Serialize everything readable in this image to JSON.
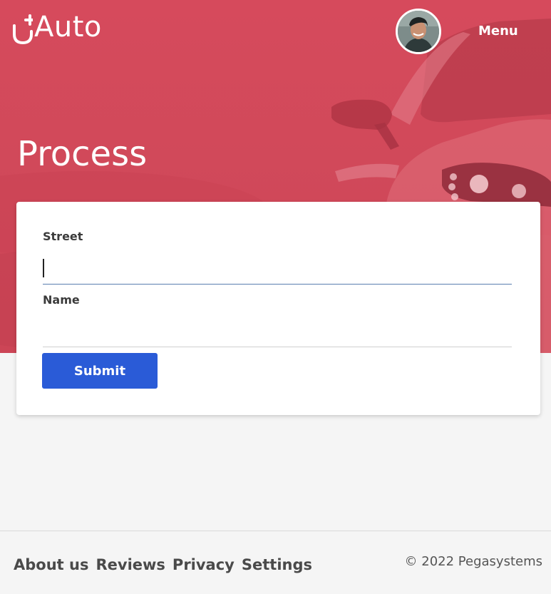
{
  "app": {
    "name": "Auto",
    "brand_color": "#d3495b"
  },
  "header": {
    "menu_label": "Menu",
    "avatar_icon": "user-avatar-icon"
  },
  "page": {
    "title": "Process"
  },
  "form": {
    "street_label": "Street",
    "street_value": "",
    "street_placeholder": "",
    "name_label": "Name",
    "name_value": "",
    "name_placeholder": "",
    "submit_label": "Submit",
    "submit_color": "#2a5bd7"
  },
  "footer": {
    "links": [
      "About us",
      "Reviews",
      "Privacy",
      "Settings"
    ],
    "copyright": "© 2022 Pegasystems"
  }
}
